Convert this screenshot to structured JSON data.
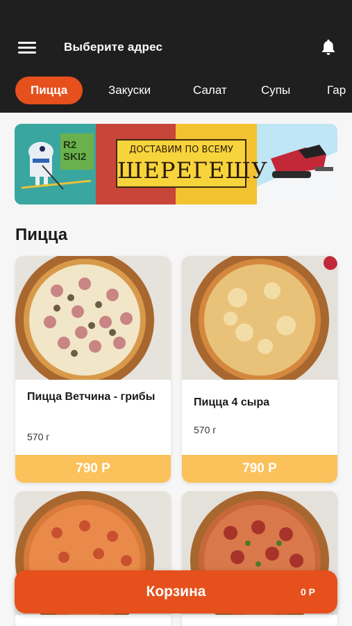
{
  "header": {
    "address_label": "Выберите адрес",
    "menu_icon": "hamburger-menu-icon",
    "notification_icon": "bell-icon"
  },
  "tabs": [
    {
      "label": "Пицца",
      "active": true
    },
    {
      "label": "Закуски",
      "active": false
    },
    {
      "label": "Салат",
      "active": false
    },
    {
      "label": "Супы",
      "active": false
    },
    {
      "label": "Гар",
      "active": false
    }
  ],
  "banner": {
    "logo_text": "R2 SKI2",
    "line1": "ДОСТАВИМ ПО ВСЕМУ",
    "line2": "ШЕРЕГЕШУ"
  },
  "section": {
    "title": "Пицца"
  },
  "products": [
    {
      "name": "Пицца Ветчина - грибы",
      "weight": "570 г",
      "price": "790 Р"
    },
    {
      "name": "Пицца 4 сыра",
      "weight": "570 г",
      "price": "790 Р"
    },
    {
      "name": "",
      "weight": "",
      "price": ""
    },
    {
      "name": "",
      "weight": "",
      "price": ""
    }
  ],
  "cart": {
    "label": "Корзина",
    "total": "0 Р"
  },
  "colors": {
    "accent": "#e6501c",
    "header_bg": "#1f1f1f",
    "price_bg": "#fbc15a"
  }
}
